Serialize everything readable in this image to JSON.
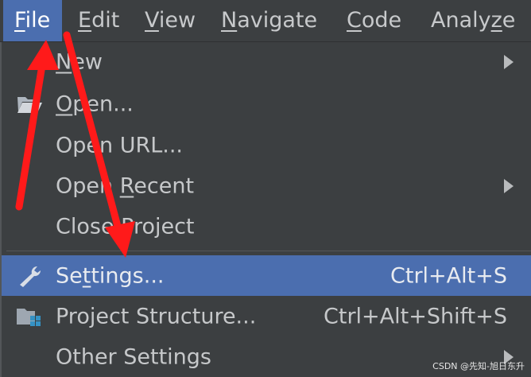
{
  "menubar": {
    "items": [
      {
        "mnemonic": "F",
        "rest": "ile"
      },
      {
        "mnemonic": "E",
        "rest": "dit"
      },
      {
        "mnemonic": "V",
        "rest": "iew"
      },
      {
        "mnemonic": "N",
        "rest": "avigate"
      },
      {
        "mnemonic": "C",
        "rest": "ode"
      },
      {
        "pre": "Analy",
        "mnemonic": "z",
        "rest": "e"
      }
    ]
  },
  "file_menu": {
    "new": {
      "mnemonic": "N",
      "rest": "ew"
    },
    "open": {
      "mnemonic": "O",
      "rest": "pen..."
    },
    "open_url": {
      "label": "Open URL..."
    },
    "open_recent": {
      "pre": "Open ",
      "mnemonic": "R",
      "rest": "ecent"
    },
    "close_project": {
      "label": "Close Project"
    },
    "settings": {
      "pre": "Se",
      "mnemonic": "t",
      "rest": "tings...",
      "shortcut": "Ctrl+Alt+S"
    },
    "project_structure": {
      "label": "Project Structure...",
      "shortcut": "Ctrl+Alt+Shift+S"
    },
    "other_settings": {
      "label": "Other Settings"
    }
  },
  "watermark": "CSDN @先知-旭日东升",
  "colors": {
    "background": "#3c3f41",
    "selection": "#4b6eaf",
    "annotation_arrow": "#ff1a1a"
  },
  "icons": {
    "open": "folder-open-icon",
    "settings": "wrench-icon",
    "project_structure": "project-structure-icon",
    "submenu": "chevron-right-icon"
  }
}
